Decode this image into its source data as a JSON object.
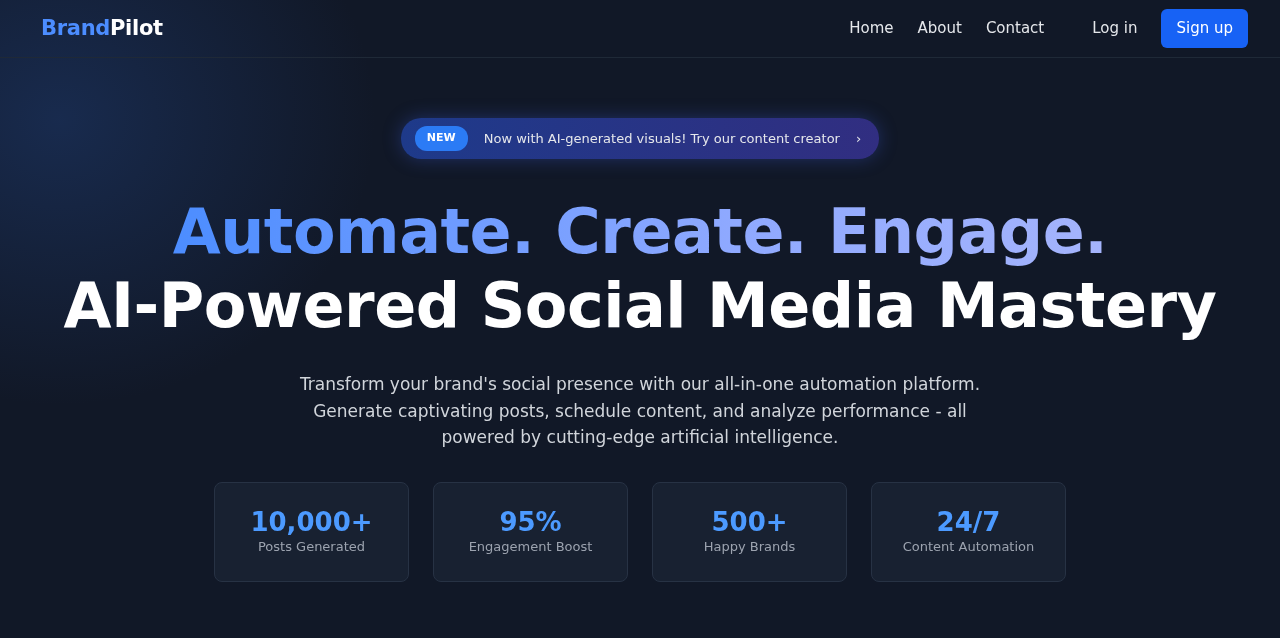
{
  "navbar": {
    "brand": {
      "accent": "Brand",
      "rest": "Pilot"
    },
    "links": [
      {
        "label": "Home"
      },
      {
        "label": "About"
      },
      {
        "label": "Contact"
      }
    ],
    "login": "Log in",
    "signup": "Sign up"
  },
  "hero": {
    "announcement": {
      "badge": "NEW",
      "text": "Now with AI-generated visuals! Try our content creator",
      "chevron": "›"
    },
    "headline_gradient": "Automate. Create. Engage.",
    "headline": "AI-Powered Social Media Mastery",
    "description": "Transform your brand's social presence with our all-in-one automation platform. Generate captivating posts, schedule content, and analyze performance - all powered by cutting-edge artificial intelligence.",
    "stats": [
      {
        "value": "10,000+",
        "label": "Posts Generated"
      },
      {
        "value": "95%",
        "label": "Engagement Boost"
      },
      {
        "value": "500+",
        "label": "Happy Brands"
      },
      {
        "value": "24/7",
        "label": "Content Automation"
      }
    ]
  }
}
